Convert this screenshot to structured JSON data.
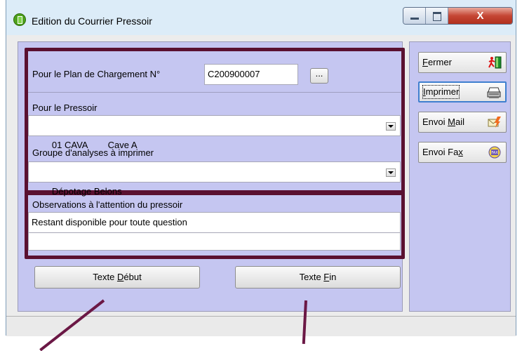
{
  "window": {
    "title": "Edition du Courrier Pressoir",
    "close_glyph": "X"
  },
  "plan": {
    "label": "Pour le Plan de Chargement N°",
    "value": "C200900007",
    "browse_label": "..."
  },
  "pressoir": {
    "label": "Pour le Pressoir",
    "value": "01 CAVA        Cave A"
  },
  "analyses": {
    "label": "Groupe d'analyses à imprimer",
    "value": "Dépotage Belons"
  },
  "observations": {
    "label": "Observations à l'attention du pressoir",
    "line1": "Restant disponible pour toute question",
    "line2": ""
  },
  "buttons": {
    "texte_debut": {
      "pre": "Texte ",
      "key": "D",
      "post": "ébut"
    },
    "texte_fin": {
      "pre": "Texte ",
      "key": "F",
      "post": "in"
    }
  },
  "side": {
    "fermer": {
      "pre": "",
      "key": "F",
      "post": "ermer",
      "icon": "exit-icon"
    },
    "imprimer": {
      "pre": "",
      "key": "I",
      "post": "mprimer",
      "icon": "printer-icon"
    },
    "mail": {
      "pre": "Envoi ",
      "key": "M",
      "post": "ail",
      "icon": "mail-icon"
    },
    "fax": {
      "pre": "Envoi Fa",
      "key": "x",
      "post": "",
      "icon": "fax-icon"
    }
  },
  "colors": {
    "frame": "#5a1030",
    "panel": "#c5c6f1",
    "annotation_arrow": "#6b1845"
  }
}
